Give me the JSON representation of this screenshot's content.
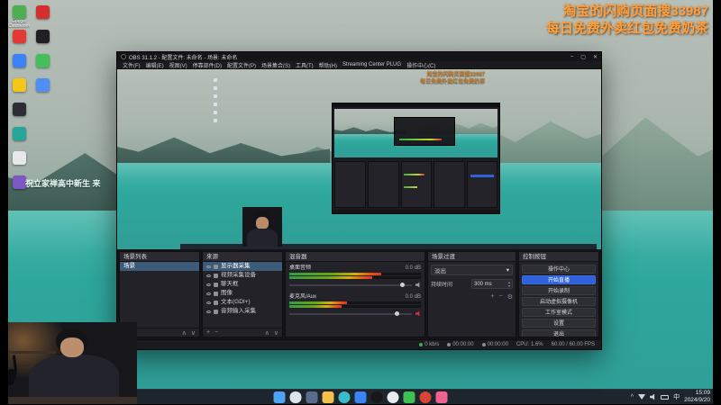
{
  "stream_overlay": {
    "line1": "淘宝的闪购页面搜33987",
    "line2": "每日免费外卖红包免费奶茶"
  },
  "desktop": {
    "note": "祝立家禅高中新生 来",
    "icons": [
      {
        "name": "google-classroom",
        "color": "#4caf50",
        "label": "Google Classroom"
      },
      {
        "name": "app-red-1",
        "color": "#e53935",
        "label": ""
      },
      {
        "name": "app-blue-1",
        "color": "#3b82f6",
        "label": ""
      },
      {
        "name": "app-yellow",
        "color": "#f5c518",
        "label": ""
      },
      {
        "name": "app-dark-1",
        "color": "#2d2d33",
        "label": ""
      },
      {
        "name": "app-teal",
        "color": "#26a69a",
        "label": ""
      },
      {
        "name": "app-white",
        "color": "#e8e8ec",
        "label": ""
      },
      {
        "name": "app-purple",
        "color": "#7e57c2",
        "label": ""
      },
      {
        "name": "app-red-2",
        "color": "#d32f2f",
        "label": ""
      },
      {
        "name": "app-dark-2",
        "color": "#1f1f24",
        "label": ""
      },
      {
        "name": "app-green",
        "color": "#43c05c",
        "label": ""
      },
      {
        "name": "app-blue-2",
        "color": "#4f8ef7",
        "label": ""
      }
    ]
  },
  "obs": {
    "window_title": "OBS 31.1.2 - 配置文件: 未命名 - 场景: 未命名",
    "window_buttons": {
      "minimize": "–",
      "maximize": "▢",
      "close": "✕"
    },
    "menu": [
      "文件(F)",
      "编辑(E)",
      "视图(V)",
      "停靠部件(D)",
      "配置文件(P)",
      "场景集合(S)",
      "工具(T)",
      "帮助(H)",
      "Streaming Center PLUG",
      "操作中心(C)"
    ],
    "dock_toolbar": [
      {
        "name": "add-icon",
        "glyph": "+"
      },
      {
        "name": "remove-icon",
        "glyph": "−"
      },
      {
        "name": "move-up-icon",
        "glyph": "∧"
      },
      {
        "name": "move-down-icon",
        "glyph": "∨"
      }
    ],
    "docks": {
      "scenes": {
        "title": "场景列表",
        "items": [
          {
            "label": "场景",
            "selected": true
          }
        ]
      },
      "sources": {
        "title": "来源",
        "items": [
          {
            "label": "显示器采集",
            "icon": "display-capture",
            "selected": true
          },
          {
            "label": "视频采集设备",
            "icon": "video-capture",
            "selected": false
          },
          {
            "label": "聊天框",
            "icon": "browser-source",
            "selected": false
          },
          {
            "label": "图像",
            "icon": "image-source",
            "selected": false
          },
          {
            "label": "文本(GDI+)",
            "icon": "text-source",
            "selected": false
          },
          {
            "label": "音频输入采集",
            "icon": "audio-input",
            "selected": false
          }
        ]
      },
      "mixer": {
        "title": "混音器",
        "channels": [
          {
            "name": "桌面音频",
            "db": "0.0 dB",
            "meter": 0.7,
            "slider": 0.93,
            "muted": false
          },
          {
            "name": "麦克风/Aux",
            "db": "0.0 dB",
            "meter": 0.44,
            "slider": 0.88,
            "muted": true
          }
        ]
      },
      "transitions": {
        "title": "场景过渡",
        "selected": "淡出",
        "duration_label": "持续时间",
        "duration_value": "300 ms"
      },
      "controls": {
        "title": "控制按钮",
        "buttons": [
          {
            "label": "操作中心",
            "name": "action-center-button",
            "primary": false
          },
          {
            "label": "开始直播",
            "name": "start-streaming-button",
            "primary": true
          },
          {
            "label": "开始录制",
            "name": "start-recording-button",
            "primary": false
          },
          {
            "label": "启动虚拟摄像机",
            "name": "virtual-camera-button",
            "primary": false
          },
          {
            "label": "工作室模式",
            "name": "studio-mode-button",
            "primary": false
          },
          {
            "label": "设置",
            "name": "settings-button",
            "primary": false
          },
          {
            "label": "退出",
            "name": "exit-button",
            "primary": false
          }
        ]
      }
    },
    "status_bar": [
      {
        "text": "0 kb/s",
        "dot": "#37b24d",
        "name": "bitrate"
      },
      {
        "text": "00:00:00",
        "dot": "#868e96",
        "name": "stream-time"
      },
      {
        "text": "00:00:00",
        "dot": "#868e96",
        "name": "record-time"
      },
      {
        "text": "CPU: 1.6%",
        "dot": "",
        "name": "cpu"
      },
      {
        "text": "60.00 / 60.00 FPS",
        "dot": "",
        "name": "fps"
      }
    ]
  },
  "taskbar": {
    "icons": [
      {
        "name": "start",
        "color": "#4da3f5",
        "shape": "square"
      },
      {
        "name": "search",
        "color": "#dfe3ea",
        "shape": "pill"
      },
      {
        "name": "task-view",
        "color": "#5b6b8c",
        "shape": "square"
      },
      {
        "name": "file-explorer",
        "color": "#f3c14b",
        "shape": "square"
      },
      {
        "name": "edge",
        "color": "#38bdc8",
        "shape": "circle"
      },
      {
        "name": "store",
        "color": "#3b82f6",
        "shape": "square"
      },
      {
        "name": "obs",
        "color": "#17171c",
        "shape": "circle"
      },
      {
        "name": "qq",
        "color": "#e8ebf0",
        "shape": "circle"
      },
      {
        "name": "wechat",
        "color": "#3ec152",
        "shape": "square"
      },
      {
        "name": "netease-music",
        "color": "#d94436",
        "shape": "circle"
      },
      {
        "name": "browser",
        "color": "#f06292",
        "shape": "square"
      }
    ],
    "ime": "中",
    "time": "15:09",
    "date": "2024/9/20"
  }
}
